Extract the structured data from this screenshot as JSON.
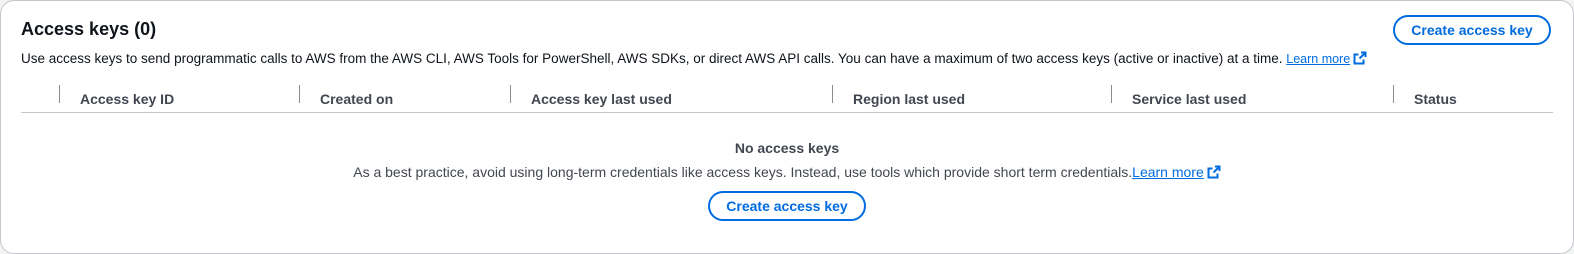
{
  "header": {
    "title": "Access keys (0)",
    "create_button_label": "Create access key"
  },
  "description": {
    "text": "Use access keys to send programmatic calls to AWS from the AWS CLI, AWS Tools for PowerShell, AWS SDKs, or direct AWS API calls. You can have a maximum of two access keys (active or inactive) at a time.",
    "learn_more_label": "Learn more"
  },
  "table": {
    "columns": [
      {
        "label": "Access key ID"
      },
      {
        "label": "Created on"
      },
      {
        "label": "Access key last used"
      },
      {
        "label": "Region last used"
      },
      {
        "label": "Service last used"
      },
      {
        "label": "Status"
      }
    ]
  },
  "empty_state": {
    "title": "No access keys",
    "description": "As a best practice, avoid using long-term credentials like access keys. Instead, use tools which provide short term credentials.",
    "learn_more_label": "Learn more",
    "create_button_label": "Create access key"
  },
  "colors": {
    "accent": "#006ce0",
    "border": "#c6c6cd",
    "text": "#0f141a",
    "muted_text": "#424650"
  },
  "icons": {
    "external_link": "external-link-icon"
  }
}
